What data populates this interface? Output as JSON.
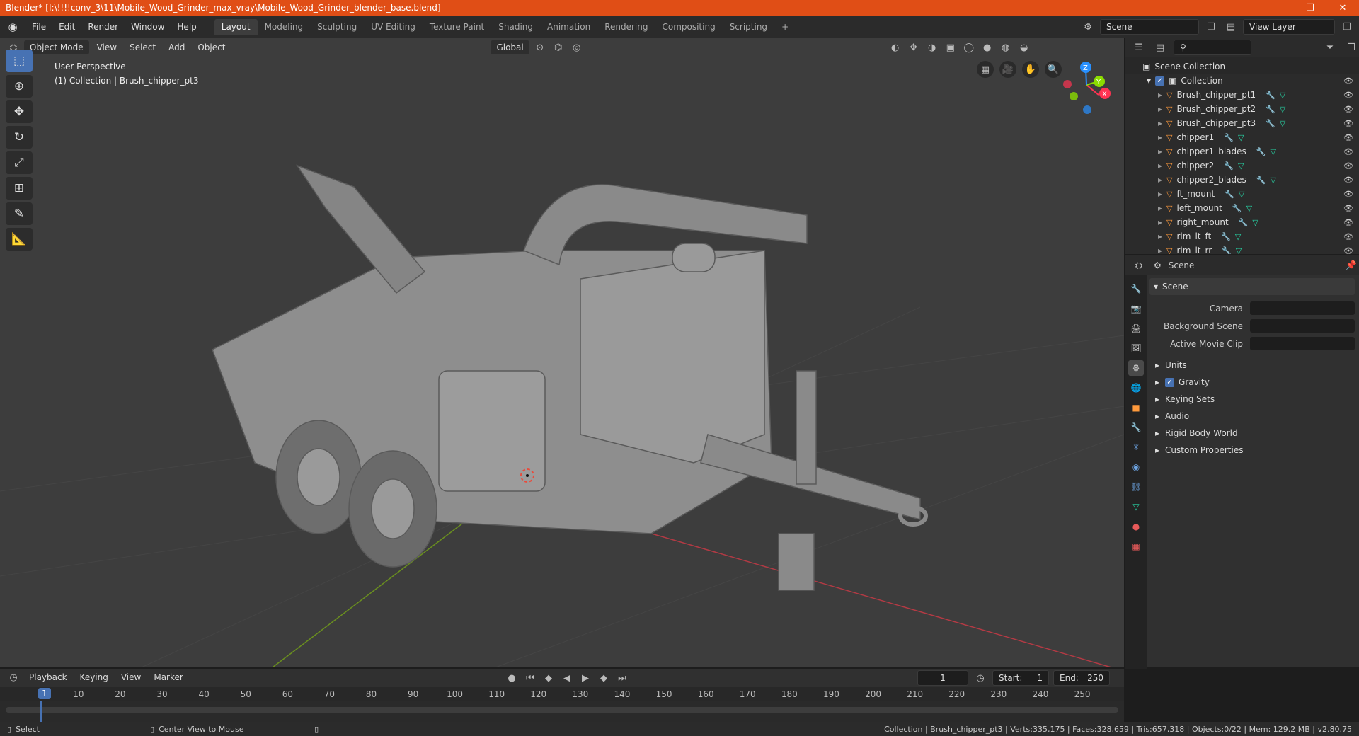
{
  "window": {
    "title": "Blender* [I:\\!!!!conv_3\\11\\Mobile_Wood_Grinder_max_vray\\Mobile_Wood_Grinder_blender_base.blend]",
    "minimize": "–",
    "restore": "❐",
    "close": "✕"
  },
  "menus": [
    "File",
    "Edit",
    "Render",
    "Window",
    "Help"
  ],
  "workspaces": [
    "Layout",
    "Modeling",
    "Sculpting",
    "UV Editing",
    "Texture Paint",
    "Shading",
    "Animation",
    "Rendering",
    "Compositing",
    "Scripting"
  ],
  "scene_field": "Scene",
  "view_layer_field": "View Layer",
  "viewport": {
    "mode": "Object Mode",
    "menus": [
      "View",
      "Select",
      "Add",
      "Object"
    ],
    "orientation": "Global",
    "info_line1": "User Perspective",
    "info_line2": "(1) Collection | Brush_chipper_pt3",
    "axis_labels": {
      "x": "X",
      "y": "Y",
      "z": "Z"
    }
  },
  "outliner": {
    "root": "Scene Collection",
    "collection": "Collection",
    "items": [
      "Brush_chipper_pt1",
      "Brush_chipper_pt2",
      "Brush_chipper_pt3",
      "chipper1",
      "chipper1_blades",
      "chipper2",
      "chipper2_blades",
      "ft_mount",
      "left_mount",
      "right_mount",
      "rim_lt_ft",
      "rim_lt_rr"
    ]
  },
  "properties": {
    "header": "Scene",
    "panel": "Scene",
    "rows": [
      {
        "label": "Camera",
        "value": ""
      },
      {
        "label": "Background Scene",
        "value": ""
      },
      {
        "label": "Active Movie Clip",
        "value": ""
      }
    ],
    "subpanels": [
      "Units",
      "Gravity",
      "Keying Sets",
      "Audio",
      "Rigid Body World",
      "Custom Properties"
    ]
  },
  "timeline": {
    "menus": [
      "Playback",
      "Keying",
      "View",
      "Marker"
    ],
    "current_frame": "1",
    "start_label": "Start:",
    "start": "1",
    "end_label": "End:",
    "end": "250",
    "ticks": [
      "1",
      "10",
      "20",
      "30",
      "40",
      "50",
      "60",
      "70",
      "80",
      "90",
      "100",
      "110",
      "120",
      "130",
      "140",
      "150",
      "160",
      "170",
      "180",
      "190",
      "200",
      "210",
      "220",
      "230",
      "240",
      "250"
    ]
  },
  "status": {
    "select": "Select",
    "center_view": "Center View to Mouse",
    "stats": "Collection | Brush_chipper_pt3 | Verts:335,175 | Faces:328,659 | Tris:657,318 | Objects:0/22 | Mem: 129.2 MB | v2.80.75"
  },
  "colors": {
    "title_bar": "#e04e16",
    "accent": "#4772b3",
    "viewport_bg": "#3d3d3d",
    "x_axis": "#ff3352",
    "y_axis": "#8bdc00",
    "z_axis": "#2890ff"
  }
}
